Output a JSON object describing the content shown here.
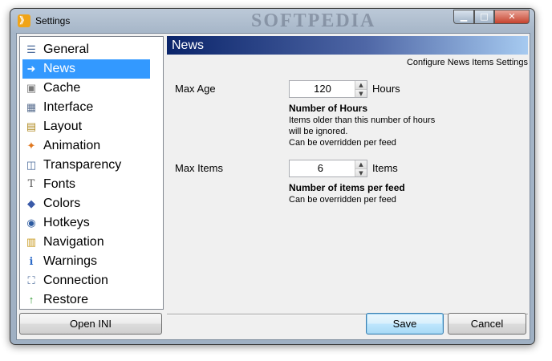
{
  "window": {
    "title": "Settings",
    "watermark": "SOFTPEDIA"
  },
  "sidebar": {
    "items": [
      {
        "label": "General",
        "icon": "general-icon"
      },
      {
        "label": "News",
        "icon": "arrow-right-icon",
        "selected": true
      },
      {
        "label": "Cache",
        "icon": "cache-icon"
      },
      {
        "label": "Interface",
        "icon": "interface-icon"
      },
      {
        "label": "Layout",
        "icon": "layout-icon"
      },
      {
        "label": "Animation",
        "icon": "animation-icon"
      },
      {
        "label": "Transparency",
        "icon": "transparency-icon"
      },
      {
        "label": "Fonts",
        "icon": "fonts-icon"
      },
      {
        "label": "Colors",
        "icon": "colors-icon"
      },
      {
        "label": "Hotkeys",
        "icon": "hotkeys-icon"
      },
      {
        "label": "Navigation",
        "icon": "navigation-icon"
      },
      {
        "label": "Warnings",
        "icon": "warnings-icon"
      },
      {
        "label": "Connection",
        "icon": "connection-icon"
      },
      {
        "label": "Restore",
        "icon": "restore-icon"
      }
    ]
  },
  "content": {
    "title": "News",
    "subtitle": "Configure News Items Settings",
    "max_age": {
      "label": "Max Age",
      "value": "120",
      "unit": "Hours",
      "desc_title": "Number of Hours",
      "desc_lines": [
        "Items older than this number of hours",
        "will be ignored.",
        "Can be overridden per feed"
      ]
    },
    "max_items": {
      "label": "Max Items",
      "value": "6",
      "unit": "Items",
      "desc_title": "Number of items per feed",
      "desc_lines": [
        "Can be overridden per feed"
      ]
    }
  },
  "buttons": {
    "open_ini": "Open INI",
    "save": "Save",
    "cancel": "Cancel"
  },
  "colors": {
    "selected": "#3399ff",
    "header_start": "#0a246a",
    "header_end": "#a6caf0"
  }
}
